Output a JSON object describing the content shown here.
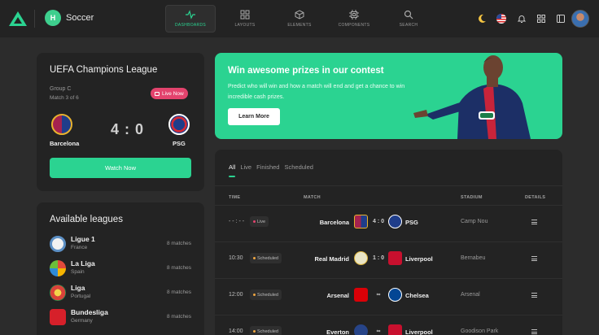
{
  "topbar": {
    "app_initial": "H",
    "app_name": "Soccer",
    "nav": [
      {
        "label": "DASHBOARDS",
        "icon": "activity-icon",
        "active": true
      },
      {
        "label": "LAYOUTS",
        "icon": "grid-icon",
        "active": false
      },
      {
        "label": "ELEMENTS",
        "icon": "cube-icon",
        "active": false
      },
      {
        "label": "COMPONENTS",
        "icon": "chip-icon",
        "active": false
      },
      {
        "label": "SEARCH",
        "icon": "search-icon",
        "active": false
      }
    ],
    "right_icons": [
      "moon-icon",
      "us-flag-icon",
      "bell-icon",
      "apps-grid-icon",
      "sidebar-toggle-icon",
      "user-avatar"
    ]
  },
  "live_match": {
    "competition": "UEFA Champions League",
    "group": "Group C",
    "round": "Match 3 of 6",
    "status": "Live Now",
    "home_team": "Barcelona",
    "away_team": "PSG",
    "home_score": "4",
    "score_separator": ":",
    "away_score": "0",
    "watch_button": "Watch Now"
  },
  "leagues": {
    "title": "Available leagues",
    "items": [
      {
        "name": "Ligue 1",
        "country": "France",
        "count": "8 matches",
        "color": "#f2f2f2"
      },
      {
        "name": "La Liga",
        "country": "Spain",
        "count": "8 matches",
        "color": "#e24a3b"
      },
      {
        "name": "Liga",
        "country": "Portugal",
        "count": "8 matches",
        "color": "#d9433a"
      },
      {
        "name": "Bundesliga",
        "country": "Germany",
        "count": "8 matches",
        "color": "#d6202a"
      }
    ]
  },
  "promo": {
    "title": "Win awesome prizes in our contest",
    "text": "Predict who will win and how a match will end and get a chance to win incredible cash prizes.",
    "button": "Learn More"
  },
  "matches": {
    "tabs": [
      "All",
      "Live",
      "Finished",
      "Scheduled"
    ],
    "active_tab": "All",
    "headers": {
      "time": "TIME",
      "match": "MATCH",
      "stadium": "STADIUM",
      "details": "DETAILS"
    },
    "rows": [
      {
        "time": "- - : - -",
        "status": "Live",
        "status_color": "#e3436d",
        "home": "Barcelona",
        "home_color": "#a5224f",
        "score": "4 : 0",
        "away": "PSG",
        "away_color": "#1f3d8a",
        "stadium": "Camp Nou"
      },
      {
        "time": "10:30",
        "status": "Scheduled",
        "status_color": "#f0a640",
        "home": "Real Madrid",
        "home_color": "#e9e4c5",
        "score": "1 : 0",
        "away": "Liverpool",
        "away_color": "#c8102e",
        "stadium": "Bernabeu"
      },
      {
        "time": "12:00",
        "status": "Scheduled",
        "status_color": "#f0a640",
        "home": "Arsenal",
        "home_color": "#db0007",
        "score": "∞",
        "away": "Chelsea",
        "away_color": "#034694",
        "stadium": "Arsenal"
      },
      {
        "time": "14:00",
        "status": "Scheduled",
        "status_color": "#f0a640",
        "home": "Everton",
        "home_color": "#274488",
        "score": "∞",
        "away": "Liverpool",
        "away_color": "#c8102e",
        "stadium": "Goodison Park"
      }
    ]
  },
  "colors": {
    "accent": "#2bd391",
    "live": "#e3436d",
    "background": "#2c2c2c",
    "card": "#232323"
  }
}
